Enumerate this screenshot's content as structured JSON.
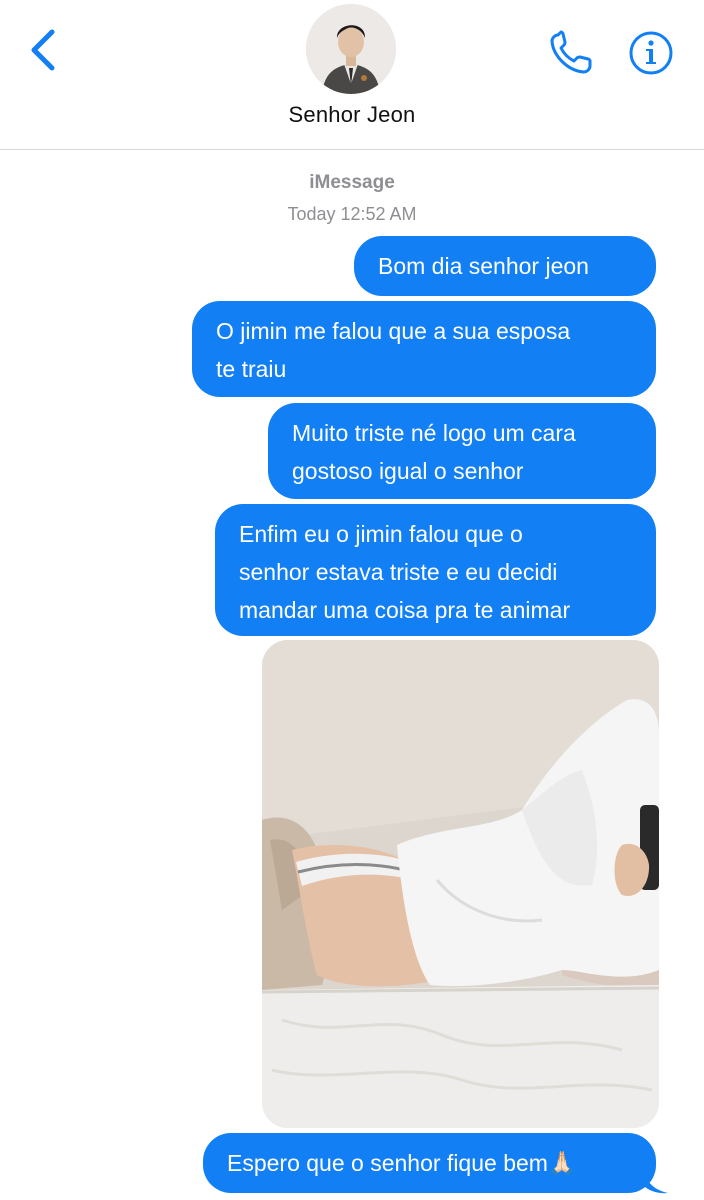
{
  "header": {
    "contact_name": "Senhor Jeon",
    "back_icon": "chevron-left-icon",
    "call_icon": "phone-icon",
    "info_icon": "info-icon",
    "accent_color": "#127ff5"
  },
  "conversation": {
    "service": "iMessage",
    "timestamp": "Today 12:52 AM",
    "messages": [
      {
        "from": "me",
        "text": "Bom dia senhor jeon"
      },
      {
        "from": "me",
        "text": "O jimin me falou que a sua esposa\nte traiu"
      },
      {
        "from": "me",
        "text": "Muito triste né logo um cara\ngostoso igual o senhor"
      },
      {
        "from": "me",
        "text": "Enfim eu o jimin falou que o\nsenhor estava triste e eu decidi\nmandar uma coisa pra te animar"
      },
      {
        "from": "me",
        "type": "photo"
      },
      {
        "from": "me",
        "text": "Espero que o senhor fique bem🙏🏻"
      }
    ]
  },
  "colors": {
    "bubble_sent": "#127ff5",
    "meta_text": "#8e8e93"
  }
}
